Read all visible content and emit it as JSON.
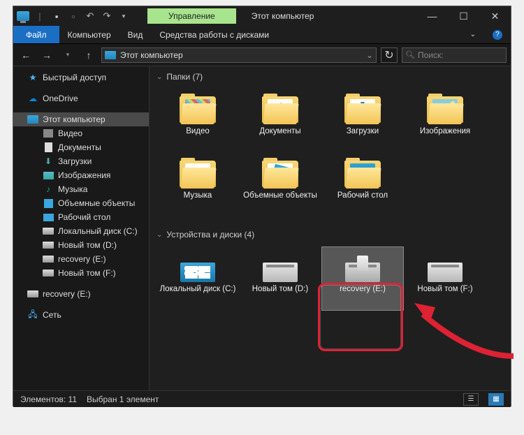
{
  "titlebar": {
    "contextual_tab": "Управление",
    "title": "Этот компьютер",
    "min": "—",
    "max": "☐",
    "close": "✕"
  },
  "menubar": {
    "file": "Файл",
    "computer": "Компьютер",
    "view": "Вид",
    "drive_tools": "Средства работы с дисками",
    "help_icon": "?"
  },
  "nav": {
    "back": "←",
    "forward": "→",
    "up": "↑",
    "breadcrumb": "Этот компьютер",
    "refresh": "↻",
    "search_placeholder": "Поиск:",
    "search_icon": "🔍"
  },
  "sidebar": {
    "quick": "Быстрый доступ",
    "onedrive": "OneDrive",
    "pc": "Этот компьютер",
    "items": [
      "Видео",
      "Документы",
      "Загрузки",
      "Изображения",
      "Музыка",
      "Объемные объекты",
      "Рабочий стол",
      "Локальный диск (C:)",
      "Новый том (D:)",
      "recovery (E:)",
      "Новый том (F:)"
    ],
    "recovery_dup": "recovery (E:)",
    "network": "Сеть"
  },
  "content": {
    "folders_header": "Папки (7)",
    "folders": [
      "Видео",
      "Документы",
      "Загрузки",
      "Изображения",
      "Музыка",
      "Объемные объекты",
      "Рабочий стол"
    ],
    "drives_header": "Устройства и диски (4)",
    "drives": [
      "Локальный диск (C:)",
      "Новый том (D:)",
      "recovery (E:)",
      "Новый том (F:)"
    ]
  },
  "status": {
    "count": "Элементов: 11",
    "selected": "Выбран 1 элемент"
  }
}
